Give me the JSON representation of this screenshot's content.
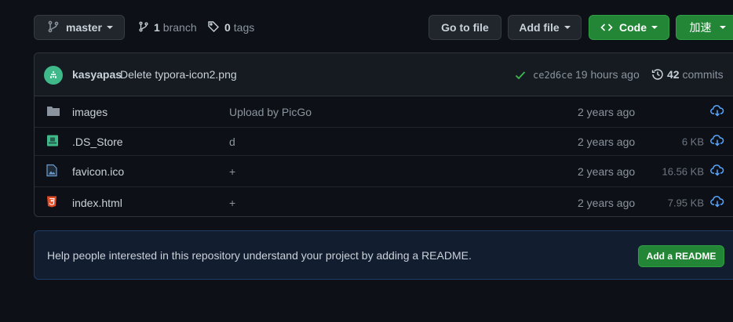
{
  "topbar": {
    "branch_name": "master",
    "branch_count": "1",
    "branch_label": "branch",
    "tag_count": "0",
    "tag_label": "tags",
    "go_to_file": "Go to file",
    "add_file": "Add file",
    "code": "Code",
    "accelerate": "加速"
  },
  "commit": {
    "author": "kasyapas",
    "message": "Delete typora-icon2.png",
    "sha": "ce2d6ce",
    "time": "19 hours ago",
    "commit_count": "42",
    "commit_label": "commits"
  },
  "files": [
    {
      "icon": "folder-icon",
      "name": "images",
      "message": "Upload by PicGo",
      "time": "2 years ago",
      "size": ""
    },
    {
      "icon": "file-icon",
      "name": ".DS_Store",
      "message": "d",
      "time": "2 years ago",
      "size": "6 KB"
    },
    {
      "icon": "image-file-icon",
      "name": "favicon.ico",
      "message": "+",
      "time": "2 years ago",
      "size": "16.56 KB"
    },
    {
      "icon": "html5-icon",
      "name": "index.html",
      "message": "+",
      "time": "2 years ago",
      "size": "7.95 KB"
    }
  ],
  "readme": {
    "text": "Help people interested in this repository understand your project by adding a README.",
    "button": "Add a README"
  },
  "colors": {
    "background": "#0d1117",
    "green": "#238636",
    "download_icon": "#58a6ff",
    "html_icon": "#e34c26",
    "ds_store_icon": "#3fb98a"
  }
}
